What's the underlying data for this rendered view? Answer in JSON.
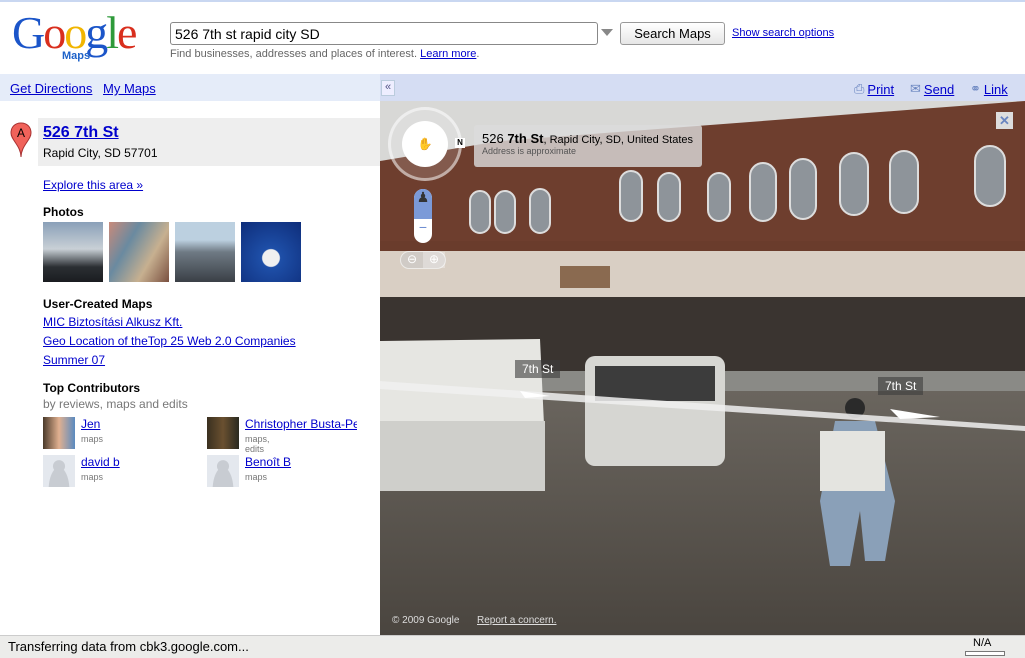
{
  "header": {
    "logo_text": "Google",
    "logo_sub": "Maps",
    "search_value": "526 7th st rapid city SD",
    "search_button": "Search Maps",
    "search_options": "Show search options",
    "hint": "Find businesses, addresses and places of interest.",
    "learn_more": "Learn more"
  },
  "nav": {
    "get_directions": "Get Directions",
    "my_maps": "My Maps",
    "collapse": "«",
    "print": "Print",
    "send": "Send",
    "link": "Link"
  },
  "result": {
    "marker": "A",
    "title": "526 7th St",
    "subtitle": "Rapid City, SD 57701",
    "explore": "Explore this area »"
  },
  "photos": {
    "heading": "Photos"
  },
  "user_maps": {
    "heading": "User-Created Maps",
    "items": [
      "MIC Biztosítási Alkusz Kft.",
      "Geo Location of theTop 25 Web 2.0 Companies",
      "Summer 07"
    ]
  },
  "contributors": {
    "heading": "Top Contributors",
    "subheading": "by reviews, maps and edits",
    "items": [
      {
        "name": "Jen",
        "role": "maps"
      },
      {
        "name": "Christopher Busta-Peck",
        "role": "maps, edits"
      },
      {
        "name": "david b",
        "role": "maps"
      },
      {
        "name": "Benoît B",
        "role": "maps"
      }
    ]
  },
  "streetview": {
    "address_num": "526",
    "address_street": "7th St",
    "address_rest": ", Rapid City, SD, United States",
    "approx": "Address is approximate",
    "street_label_1": "7th St",
    "street_label_2": "7th St",
    "copyright": "© 2009 Google",
    "report": "Report a concern.",
    "compass": "N"
  },
  "status": {
    "text": "Transferring data from cbk3.google.com...",
    "zone": "N/A"
  }
}
